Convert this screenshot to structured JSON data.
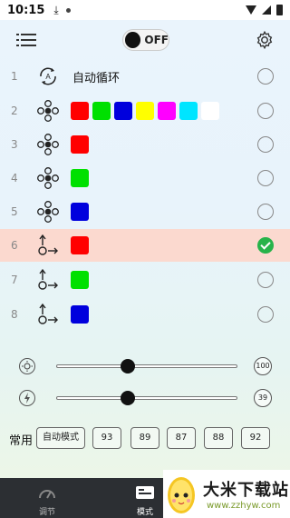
{
  "status_bar": {
    "time": "10:15",
    "download_icon": "download-arrow-icon"
  },
  "toolbar": {
    "power_label": "OFF",
    "menu_icon": "menu-list-icon",
    "settings_icon": "gear-icon"
  },
  "modes": [
    {
      "num": "1",
      "icon": "auto-cycle-icon",
      "label": "自动循环",
      "colors": [],
      "checked": false
    },
    {
      "num": "2",
      "icon": "jump-flash-icon",
      "label": "",
      "colors": [
        "#ff0000",
        "#00e000",
        "#0000dd",
        "#ffff00",
        "#ff00ff",
        "#00e5ff",
        "#ffffff"
      ],
      "checked": false
    },
    {
      "num": "3",
      "icon": "flash-icon",
      "label": "",
      "colors": [
        "#ff0000"
      ],
      "checked": false
    },
    {
      "num": "4",
      "icon": "flash-icon",
      "label": "",
      "colors": [
        "#00e000"
      ],
      "checked": false
    },
    {
      "num": "5",
      "icon": "flash-icon",
      "label": "",
      "colors": [
        "#0000dd"
      ],
      "checked": false
    },
    {
      "num": "6",
      "icon": "breathe-fade-icon",
      "label": "",
      "colors": [
        "#ff0000"
      ],
      "checked": true
    },
    {
      "num": "7",
      "icon": "breathe-fade-icon",
      "label": "",
      "colors": [
        "#00e000"
      ],
      "checked": false
    },
    {
      "num": "8",
      "icon": "breathe-fade-icon",
      "label": "",
      "colors": [
        "#0000dd"
      ],
      "checked": false
    }
  ],
  "sliders": {
    "brightness": {
      "icon": "brightness-icon",
      "value": "100",
      "level": 0.39
    },
    "speed": {
      "icon": "speed-icon",
      "value": "39",
      "level": 0.39
    }
  },
  "presets": {
    "label": "常用",
    "buttons": [
      "自动模式",
      "93",
      "89",
      "87",
      "88",
      "92"
    ]
  },
  "bottom_nav": [
    {
      "icon": "adjust-icon",
      "label": "调节"
    },
    {
      "icon": "mode-icon",
      "label": "模式"
    }
  ],
  "watermark": {
    "title": "大米下载站",
    "url": "www.zzhyw.com"
  }
}
